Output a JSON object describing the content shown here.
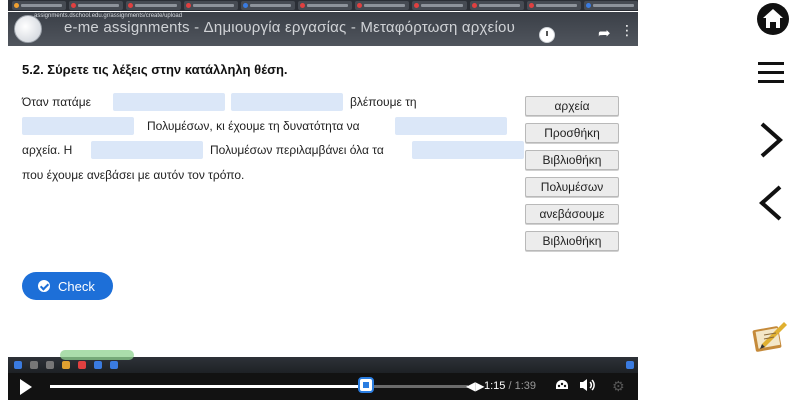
{
  "video": {
    "title": "e-me assignments - Δημιουργία εργασίας - Μεταφόρτωση αρχείου",
    "url_text": "assignments.dschool.edu.gr/assignments/create/upload",
    "tab_colors": [
      "#f0a030",
      "#e04040",
      "#e04040",
      "#e04040",
      "#3a7be0",
      "#e04040",
      "#e04040",
      "#e04040",
      "#e04040",
      "#e04040",
      "#3a7be0"
    ]
  },
  "task": {
    "title": "5.2. Σύρετε τις λέξεις στην κατάλληλη θέση.",
    "line1": {
      "part1": "Όταν πατάμε",
      "part2": "βλέπουμε τη"
    },
    "line2": {
      "part1": "Πολυμέσων, κι έχουμε τη δυνατότητα να"
    },
    "line3": {
      "part1": "αρχεία. Η",
      "part2": "Πολυμέσων περιλαμβάνει όλα τα"
    },
    "line4": {
      "part1": "που έχουμε ανεβάσει με αυτόν τον τρόπο."
    },
    "word_bank": [
      "αρχεία",
      "Προσθήκη",
      "Βιβλιοθήκη",
      "Πολυμέσων",
      "ανεβάσουμε",
      "Βιβλιοθήκη"
    ],
    "check_label": "Check"
  },
  "player": {
    "current_time": "1:15",
    "duration": "/ 1:39",
    "progress": 0.755,
    "accent": "#2a7de1"
  },
  "side_nav": {
    "icons": [
      "home-icon",
      "menu-icon",
      "next-icon",
      "previous-icon",
      "notes-icon"
    ]
  }
}
